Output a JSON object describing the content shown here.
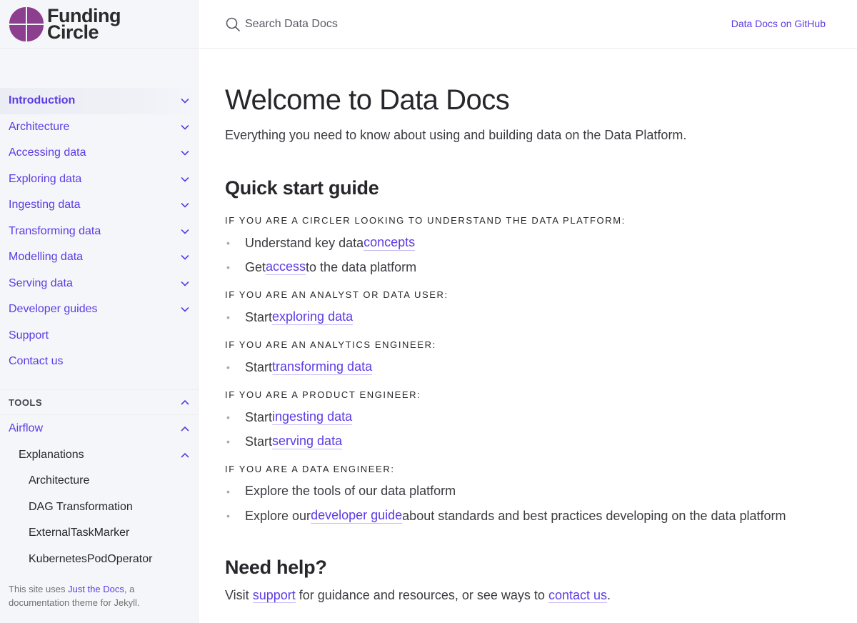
{
  "brand": {
    "name_line1": "Funding",
    "name_line2": "Circle",
    "logo_color": "#8c3e8f"
  },
  "header": {
    "search_placeholder": "Search Data Docs",
    "github_link": "Data Docs on GitHub"
  },
  "sidebar": {
    "nav": [
      {
        "label": "Introduction",
        "active": true,
        "expandable": true
      },
      {
        "label": "Architecture",
        "expandable": true
      },
      {
        "label": "Accessing data",
        "expandable": true
      },
      {
        "label": "Exploring data",
        "expandable": true
      },
      {
        "label": "Ingesting data",
        "expandable": true
      },
      {
        "label": "Transforming data",
        "expandable": true
      },
      {
        "label": "Modelling data",
        "expandable": true
      },
      {
        "label": "Serving data",
        "expandable": true
      },
      {
        "label": "Developer guides",
        "expandable": true
      },
      {
        "label": "Support",
        "expandable": false
      },
      {
        "label": "Contact us",
        "expandable": false
      }
    ],
    "tools_header": "TOOLS",
    "tools": [
      {
        "label": "Airflow",
        "level": 1,
        "expanded": true
      },
      {
        "label": "Explanations",
        "level": 2,
        "expanded": true
      },
      {
        "label": "Architecture",
        "level": 3
      },
      {
        "label": "DAG Transformation",
        "level": 3
      },
      {
        "label": "ExternalTaskMarker",
        "level": 3
      },
      {
        "label": "KubernetesPodOperator",
        "level": 3
      }
    ],
    "footer": {
      "prefix": "This site uses ",
      "link": "Just the Docs",
      "suffix": ", a documentation theme for Jekyll."
    }
  },
  "main": {
    "title": "Welcome to Data Docs",
    "lead": "Everything you need to know about using and building data on the Data Platform.",
    "quick_start_heading": "Quick start guide",
    "sections": [
      {
        "eyebrow": "If you are a Circler looking to understand the data platform:",
        "items": [
          {
            "before": "Understand key data ",
            "link": "concepts",
            "after": ""
          },
          {
            "before": "Get ",
            "link": "access",
            "after": " to the data platform"
          }
        ]
      },
      {
        "eyebrow": "If you are an analyst or data user:",
        "items": [
          {
            "before": "Start ",
            "link": "exploring data",
            "after": ""
          }
        ]
      },
      {
        "eyebrow": "If you are an analytics engineer:",
        "items": [
          {
            "before": "Start ",
            "link": "transforming data",
            "after": ""
          }
        ]
      },
      {
        "eyebrow": "If you are a product engineer:",
        "items": [
          {
            "before": "Start ",
            "link": "ingesting data",
            "after": ""
          },
          {
            "before": "Start ",
            "link": "serving data",
            "after": ""
          }
        ]
      },
      {
        "eyebrow": "If you are a data engineer:",
        "items": [
          {
            "before": "Explore the tools of our data platform",
            "link": "",
            "after": ""
          },
          {
            "before": "Explore our ",
            "link": "developer guide",
            "after": " about standards and best practices developing on the data platform"
          }
        ]
      }
    ],
    "help_heading": "Need help?",
    "help": {
      "t1": "Visit ",
      "l1": "support",
      "t2": " for guidance and resources, or see ways to ",
      "l2": "contact us",
      "t3": "."
    }
  },
  "colors": {
    "link": "#5c3be3",
    "sidebar_bg": "#f5f6fa",
    "text": "#27262b"
  }
}
